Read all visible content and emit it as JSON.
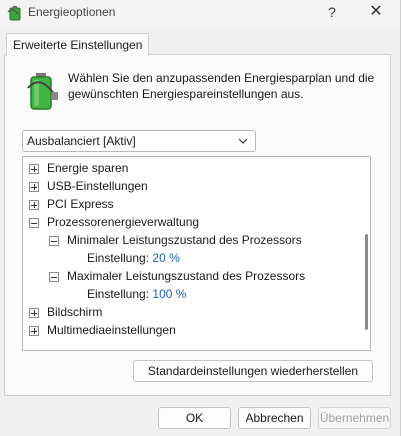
{
  "window": {
    "title": "Energieoptionen",
    "help_glyph": "?",
    "close_glyph": "✕"
  },
  "tab": {
    "label": "Erweiterte Einstellungen"
  },
  "description": "Wählen Sie den anzupassenden Energiesparplan und die gewünschten Energiespareinstellungen aus.",
  "plan_select": {
    "value": "Ausbalanciert [Aktiv]"
  },
  "tree": {
    "energie_sparen": "Energie sparen",
    "usb": "USB-Einstellungen",
    "pci": "PCI Express",
    "prozessor": "Prozessorenergieverwaltung",
    "min_state": "Minimaler Leistungszustand des Prozessors",
    "min_setting_label": "Einstellung:",
    "min_setting_value": "20 %",
    "max_state": "Maximaler Leistungszustand des Prozessors",
    "max_setting_label": "Einstellung:",
    "max_setting_value": "100 %",
    "bildschirm": "Bildschirm",
    "multimedia": "Multimediaeinstellungen"
  },
  "buttons": {
    "restore": "Standardeinstellungen wiederherstellen",
    "ok": "OK",
    "cancel": "Abbrechen",
    "apply": "Übernehmen"
  }
}
